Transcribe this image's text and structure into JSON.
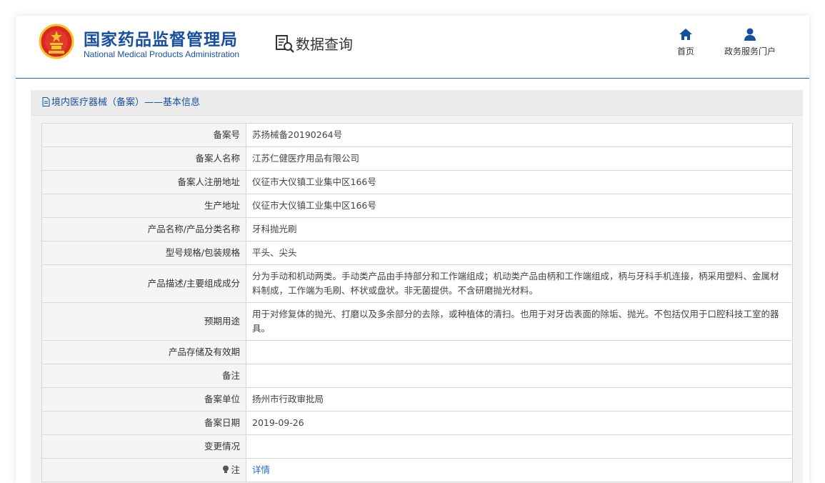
{
  "header": {
    "org_name_cn": "国家药品监督管理局",
    "org_name_en": "National Medical Products Administration",
    "section_title": "数据查询",
    "nav": [
      {
        "label": "首页",
        "icon": "home-icon"
      },
      {
        "label": "政务服务门户",
        "icon": "user-icon"
      }
    ]
  },
  "panel": {
    "title": "境内医疗器械（备案）——基本信息"
  },
  "records": [
    {
      "label": "备案号",
      "value": "苏扬械备20190264号"
    },
    {
      "label": "备案人名称",
      "value": "江苏仁健医疗用品有限公司"
    },
    {
      "label": "备案人注册地址",
      "value": "仪征市大仪镇工业集中区166号"
    },
    {
      "label": "生产地址",
      "value": "仪征市大仪镇工业集中区166号"
    },
    {
      "label": "产品名称/产品分类名称",
      "value": "牙科抛光刷"
    },
    {
      "label": "型号规格/包装规格",
      "value": "平头、尖头"
    },
    {
      "label": "产品描述/主要组成成分",
      "value": "分为手动和机动两类。手动类产品由手持部分和工作端组成；机动类产品由柄和工作端组成，柄与牙科手机连接，柄采用塑料、金属材料制成，工作端为毛刷、杯状或盘状。非无菌提供。不含研磨抛光材料。"
    },
    {
      "label": "预期用途",
      "value": "用于对修复体的抛光、打磨以及多余部分的去除，或种植体的清扫。也用于对牙齿表面的除垢、抛光。不包括仅用于口腔科技工室的器具。"
    },
    {
      "label": "产品存储及有效期",
      "value": ""
    },
    {
      "label": "备注",
      "value": ""
    },
    {
      "label": "备案单位",
      "value": "扬州市行政审批局"
    },
    {
      "label": "备案日期",
      "value": "2019-09-26"
    },
    {
      "label": "变更情况",
      "value": ""
    },
    {
      "label": "注",
      "value": "详情",
      "link": true,
      "label_icon": "bulb-icon"
    }
  ],
  "colors": {
    "brand_blue": "#1a4f9c",
    "link_blue": "#2d6bc4",
    "emblem_red": "#d8281f",
    "emblem_gold": "#f2c230"
  }
}
